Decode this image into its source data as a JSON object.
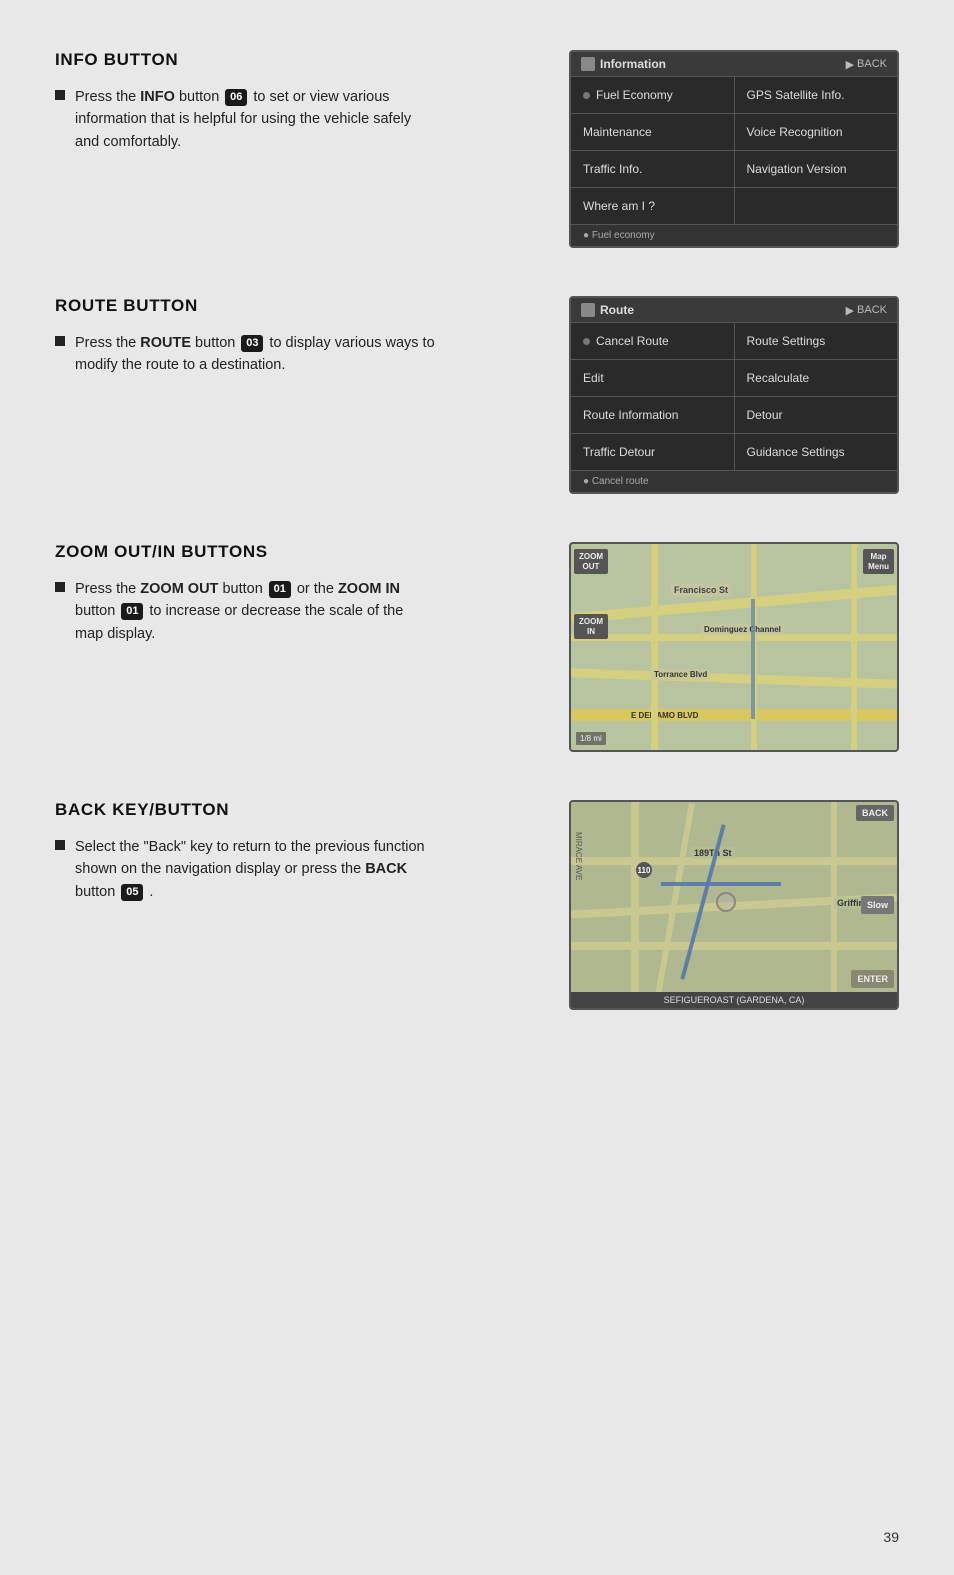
{
  "page": {
    "number": "39",
    "background": "#e8e8e8"
  },
  "sections": [
    {
      "id": "info-button",
      "title": "INFO BUTTON",
      "bullet": {
        "prefix": "Press the ",
        "bold": "INFO",
        "middle": " button ",
        "badge": "06",
        "suffix": " to set or view various information that is helpful for using the vehicle safely and comfortably."
      },
      "screen": {
        "type": "info",
        "header_icon": "■",
        "header_title": "Information",
        "header_back": "BACK",
        "items_left": [
          "Fuel Economy",
          "Maintenance",
          "Traffic Info.",
          "Where am I ?"
        ],
        "items_right": [
          "GPS Satellite Info.",
          "Voice Recognition",
          "Navigation Version",
          ""
        ],
        "footer": "● Fuel economy"
      }
    },
    {
      "id": "route-button",
      "title": "ROUTE BUTTON",
      "bullet": {
        "prefix": "Press the ",
        "bold": "ROUTE",
        "middle": " button ",
        "badge": "03",
        "suffix": " to display various ways to modify the route to a destination."
      },
      "screen": {
        "type": "route",
        "header_icon": "■",
        "header_title": "Route",
        "header_back": "BACK",
        "items_left": [
          "Cancel Route",
          "Edit",
          "Route Information",
          "Traffic Detour"
        ],
        "items_right": [
          "Route Settings",
          "Recalculate",
          "Detour",
          "Guidance Settings"
        ],
        "footer": "● Cancel route"
      }
    },
    {
      "id": "zoom-buttons",
      "title": "ZOOM OUT/IN BUTTONS",
      "bullet": {
        "prefix": "Press the ",
        "bold1": "ZOOM OUT",
        "middle1": " button ",
        "badge1": "01",
        "middle2": " or the ",
        "bold2": "ZOOM IN",
        "middle3": " button ",
        "badge2": "01",
        "suffix": " to increase or decrease the scale of the map display."
      },
      "screen": {
        "type": "zoom-map",
        "labels": [
          "Francisco St",
          "Dominguez Channel",
          "Torrance Blvd",
          "E DEL AMO BLVD"
        ],
        "btns": [
          "ZOOM OUT",
          "ZOOM IN",
          "Map Menu"
        ]
      }
    },
    {
      "id": "back-key-button",
      "title": "BACK KEY/BUTTON",
      "bullet": {
        "prefix": "Select the “Back” key to return to the previous function shown on the navigation display or press the ",
        "bold": "BACK",
        "middle": " button ",
        "badge": "05",
        "suffix": " ."
      },
      "screen": {
        "type": "back-map",
        "labels": [
          "189Th St",
          "Griffin"
        ],
        "btns": [
          "BACK",
          "Slow",
          "ENTER"
        ],
        "footer": "SEFIGUEROAST (GARDENA, CA)"
      }
    }
  ]
}
